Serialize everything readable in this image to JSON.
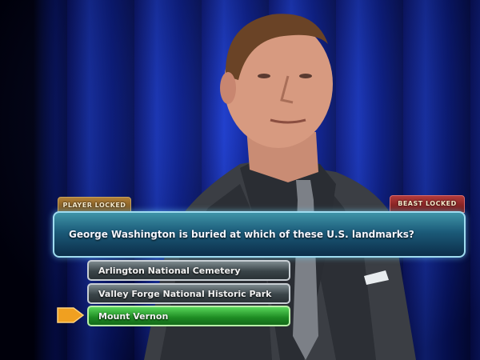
{
  "lock_tags": {
    "player": "PLAYER LOCKED",
    "beast": "BEAST LOCKED"
  },
  "question": "George Washington is buried at which of these U.S. landmarks?",
  "answers": [
    {
      "label": "Arlington National Cemetery",
      "state": "default"
    },
    {
      "label": "Valley Forge National Historic Park",
      "state": "default"
    },
    {
      "label": "Mount Vernon",
      "state": "selected"
    }
  ],
  "colors": {
    "background": "#1d3fd0",
    "question_panel": "#1b5a78",
    "selected_answer": "#1d8a22",
    "pointer": "#f0a020",
    "player_tag": "#b08038",
    "beast_tag": "#b33a3a"
  },
  "icons": {
    "pointer": "arrow-pointer-icon"
  }
}
